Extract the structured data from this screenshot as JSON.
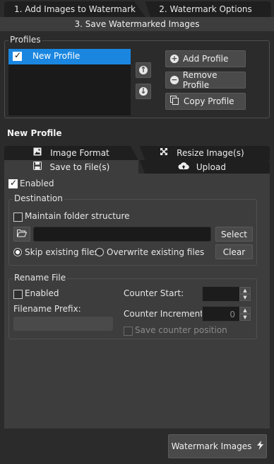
{
  "tabs": {
    "tab1": "1. Add Images to Watermark",
    "tab2": "2. Watermark Options",
    "tab3": "3. Save Watermarked Images"
  },
  "profiles": {
    "group_title": "Profiles",
    "items": [
      {
        "label": "New Profile",
        "checked": true
      }
    ],
    "add": "Add Profile",
    "remove": "Remove Profile",
    "copy": "Copy Profile"
  },
  "profile_name": "New Profile",
  "subtabs": {
    "image_format": "Image Format",
    "resize": "Resize Image(s)",
    "save": "Save to File(s)",
    "upload": "Upload"
  },
  "save": {
    "enabled_label": "Enabled",
    "destination": {
      "title": "Destination",
      "maintain_label": "Maintain folder structure",
      "path_value": "",
      "select": "Select",
      "clear": "Clear",
      "skip_label": "Skip existing files",
      "overwrite_label": "Overwrite existing files"
    },
    "rename": {
      "title": "Rename File",
      "enabled_label": "Enabled",
      "prefix_label": "Filename Prefix:",
      "counter_start_label": "Counter Start:",
      "counter_start_value": "",
      "counter_inc_label": "Counter Increment:",
      "counter_inc_value": "0",
      "save_counter_label": "Save counter position"
    }
  },
  "action": {
    "watermark": "Watermark Images"
  }
}
